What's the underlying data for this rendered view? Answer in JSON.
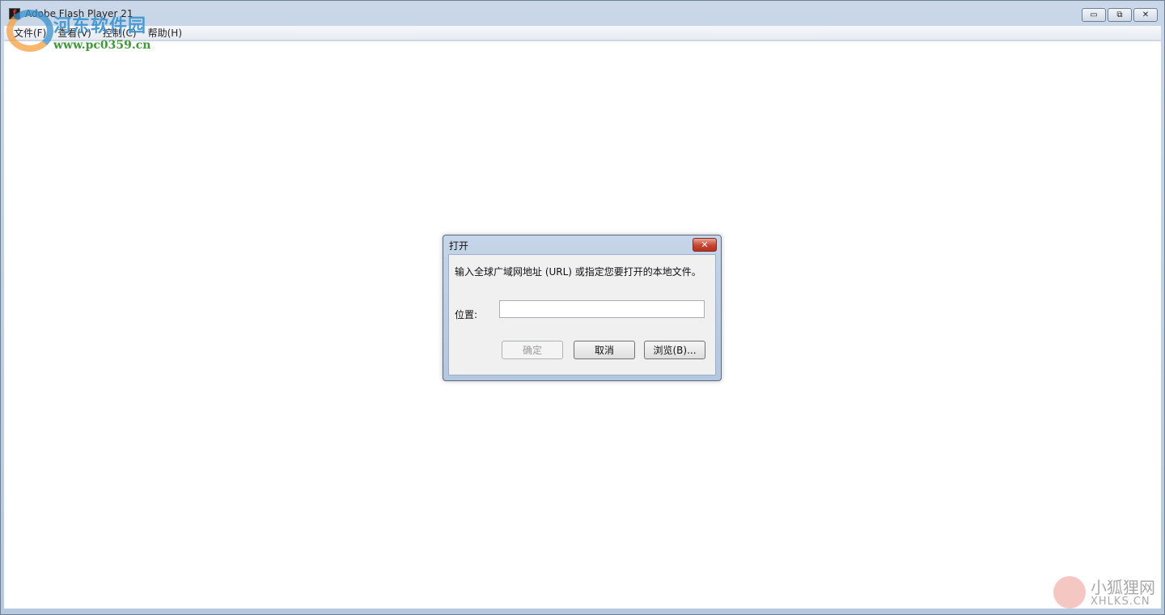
{
  "window": {
    "title": "Adobe Flash Player 21",
    "controls": {
      "minimize": "▭",
      "restore": "⧉",
      "close": "✕"
    }
  },
  "menubar": {
    "items": [
      "文件(F)",
      "查看(V)",
      "控制(C)",
      "帮助(H)"
    ]
  },
  "dialog": {
    "title": "打开",
    "close_symbol": "✕",
    "prompt": "输入全球广域网地址 (URL) 或指定您要打开的本地文件。",
    "location_label": "位置:",
    "location_value": "",
    "ok_label": "确定",
    "cancel_label": "取消",
    "browse_label": "浏览(B)..."
  },
  "watermarks": {
    "top_left_name": "河东软件园",
    "top_left_url": "www.pc0359.cn",
    "bottom_right_name": "小狐狸网",
    "bottom_right_url": "XHLKS.CN"
  },
  "colors": {
    "dialog_close": "#c6452f",
    "client_bg": "#ffffff",
    "frame": "#b7c9df"
  }
}
